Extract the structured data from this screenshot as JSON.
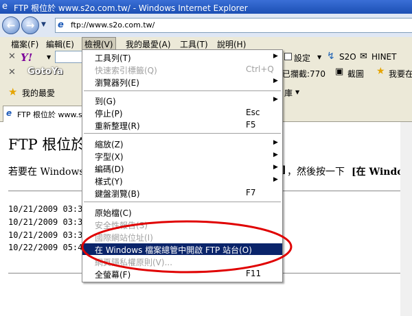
{
  "window": {
    "title": "FTP 根位於 www.s2o.com.tw/ - Windows Internet Explorer"
  },
  "address": {
    "url": "ftp://www.s2o.com.tw/"
  },
  "menubar": [
    "檔案(F)",
    "編輯(E)",
    "檢視(V)",
    "我的最愛(A)",
    "工具(T)",
    "說明(H)"
  ],
  "toolbar1": {
    "settings": "設定",
    "s2o": "S2O",
    "hinet": "HINET"
  },
  "toolbar2": {
    "gotoya": "GotoYa",
    "collected": "已攔截:770",
    "screenshot": "截圖",
    "favs_partial": "我要在台"
  },
  "favbar": {
    "favorites": "我的最愛",
    "right_partial": "庫"
  },
  "tab": {
    "label": "FTP 根位於 www.s"
  },
  "page": {
    "heading": "FTP 根位於",
    "para_left": "若要在 Windows",
    "para_right": "，然後按一下",
    "para_bold": "[在 Window",
    "bracket": "]",
    "listing": [
      "10/21/2009 03:3",
      "10/21/2009 03:3",
      "10/21/2009 03:3",
      "10/22/2009 05:4"
    ]
  },
  "view_menu": {
    "items": [
      {
        "label": "工具列(T)",
        "shortcut": "",
        "submenu": true,
        "disabled": false
      },
      {
        "label": "快速索引標籤(Q)",
        "shortcut": "Ctrl+Q",
        "submenu": false,
        "disabled": true
      },
      {
        "label": "瀏覽器列(E)",
        "shortcut": "",
        "submenu": true,
        "disabled": false
      },
      {
        "label": "到(G)",
        "shortcut": "",
        "submenu": true,
        "disabled": false
      },
      {
        "label": "停止(P)",
        "shortcut": "Esc",
        "submenu": false,
        "disabled": false
      },
      {
        "label": "重新整理(R)",
        "shortcut": "F5",
        "submenu": false,
        "disabled": false
      },
      {
        "label": "縮放(Z)",
        "shortcut": "",
        "submenu": true,
        "disabled": false
      },
      {
        "label": "字型(X)",
        "shortcut": "",
        "submenu": true,
        "disabled": false
      },
      {
        "label": "編碼(D)",
        "shortcut": "",
        "submenu": true,
        "disabled": false
      },
      {
        "label": "樣式(Y)",
        "shortcut": "",
        "submenu": true,
        "disabled": false
      },
      {
        "label": "鍵盤瀏覽(B)",
        "shortcut": "F7",
        "submenu": false,
        "disabled": false
      },
      {
        "label": "原始檔(C)",
        "shortcut": "",
        "submenu": false,
        "disabled": false
      },
      {
        "label": "安全性報告(S)",
        "shortcut": "",
        "submenu": false,
        "disabled": true
      },
      {
        "label": "國際網站位址(I)",
        "shortcut": "",
        "submenu": false,
        "disabled": true
      },
      {
        "label": "在 Windows 檔案總管中開啟 FTP 站台(O)",
        "shortcut": "",
        "submenu": false,
        "disabled": false,
        "highlighted": true
      },
      {
        "label": "網頁隱私權原則(V)...",
        "shortcut": "",
        "submenu": false,
        "disabled": true
      },
      {
        "label": "全螢幕(F)",
        "shortcut": "F11",
        "submenu": false,
        "disabled": false
      }
    ]
  },
  "colors": {
    "highlight": "#0a246a",
    "annotation_oval": "#e00000"
  }
}
